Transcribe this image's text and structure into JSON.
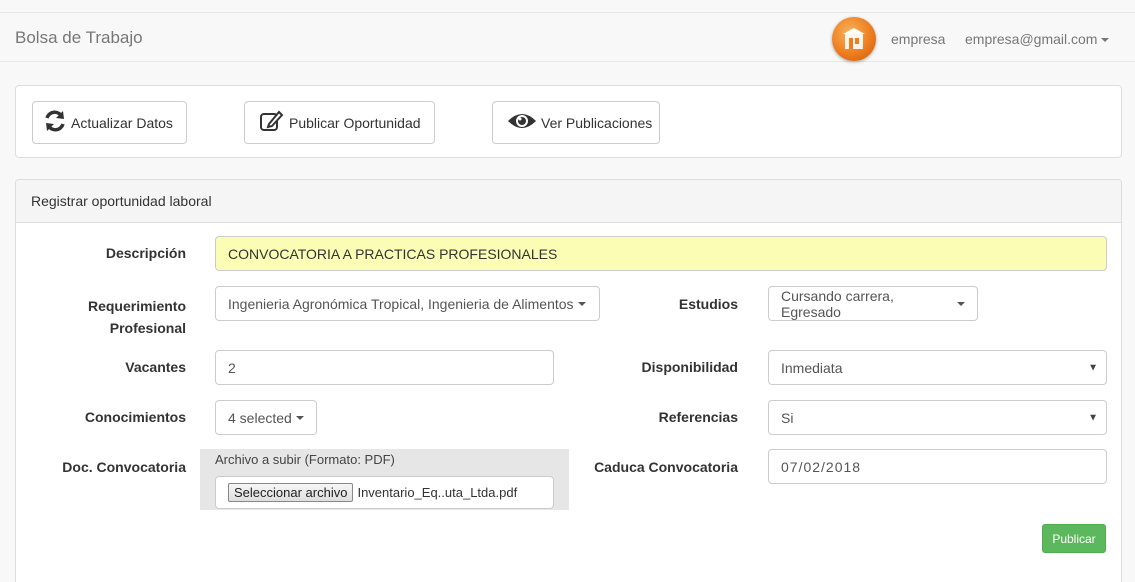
{
  "navbar": {
    "brand": "Bolsa de Trabajo",
    "user_label": "empresa",
    "email": "empresa@gmail.com"
  },
  "toolbar": {
    "update_label": "Actualizar Datos",
    "publish_label": "Publicar Oportunidad",
    "view_label": "Ver Publicaciones",
    "update_icon": "refresh-icon",
    "publish_icon": "edit-icon",
    "view_icon": "eye-icon"
  },
  "form": {
    "panel_title": "Registrar oportunidad laboral",
    "descripcion_label": "Descripción",
    "descripcion_value": "CONVOCATORIA A PRACTICAS PROFESIONALES",
    "requerimiento_label": "Requerimiento Profesional",
    "requerimiento_value": "Ingenieria Agronómica Tropical, Ingenieria de Alimentos",
    "estudios_label": "Estudios",
    "estudios_value": "Cursando carrera, Egresado",
    "vacantes_label": "Vacantes",
    "vacantes_value": "2",
    "disponibilidad_label": "Disponibilidad",
    "disponibilidad_value": "Inmediata",
    "conocimientos_label": "Conocimientos",
    "conocimientos_value": "4 selected",
    "referencias_label": "Referencias",
    "referencias_value": "Si",
    "doc_label": "Doc. Convocatoria",
    "file_caption": "Archivo a subir (Formato: PDF)",
    "file_button": "Seleccionar archivo",
    "file_name": "Inventario_Eq..uta_Ltda.pdf",
    "caduca_label": "Caduca Convocatoria",
    "caduca_value": "07/02/2018",
    "submit_label": "Publicar"
  },
  "colors": {
    "highlight_input": "#fbfdb5",
    "submit_green": "#5cb85c",
    "logo_orange": "#ee7d1f"
  }
}
